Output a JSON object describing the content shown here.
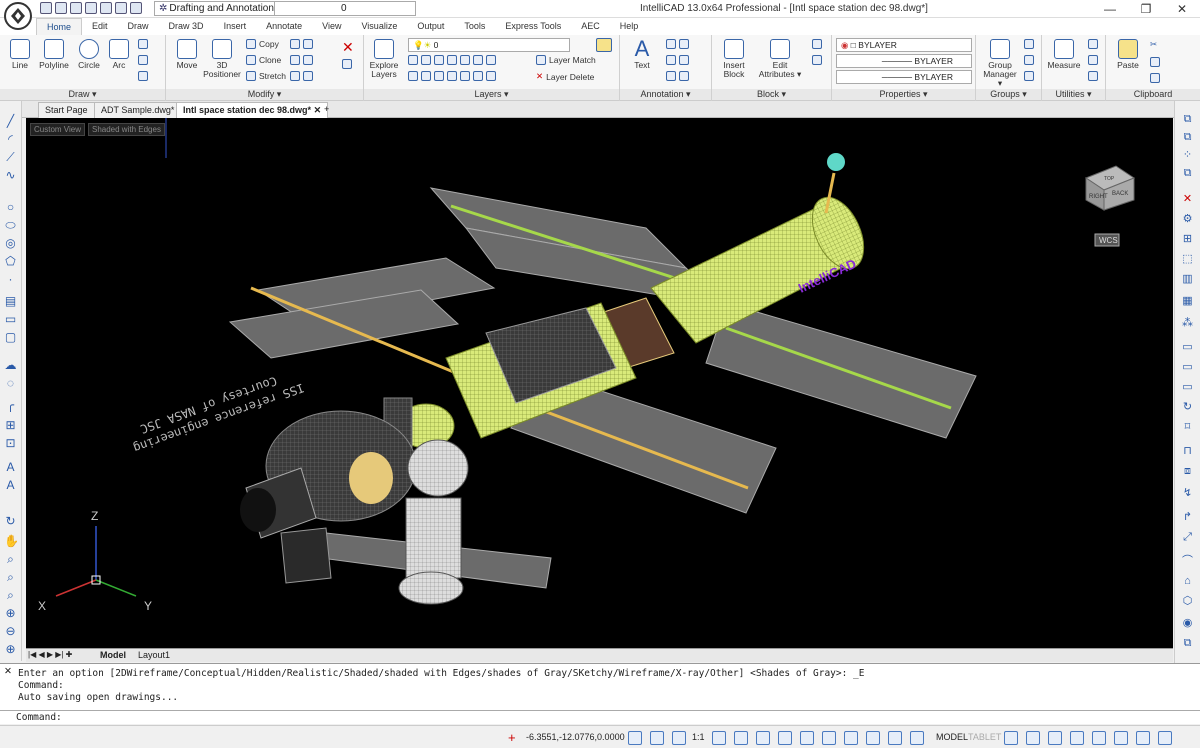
{
  "window": {
    "title": "IntelliCAD 13.0x64 Professional  - [Intl space station dec 98.dwg*]",
    "controls": [
      "—",
      "❐",
      "✕"
    ]
  },
  "qat": {
    "workspace": "Drafting and Annotation",
    "layer_value": "0"
  },
  "menu": [
    "Home",
    "Edit",
    "Draw",
    "Draw 3D",
    "Insert",
    "Annotate",
    "View",
    "Visualize",
    "Output",
    "Tools",
    "Express Tools",
    "AEC",
    "Help"
  ],
  "ribbon": {
    "draw": {
      "label": "Draw ▾",
      "tools": [
        "Line",
        "Polyline",
        "Circle",
        "Arc"
      ]
    },
    "modify": {
      "label": "Modify ▾",
      "move": "Move",
      "positioner": "3D\nPositioner",
      "copy": "Copy",
      "clone": "Clone",
      "stretch": "Stretch"
    },
    "layers": {
      "label": "Layers ▾",
      "explore": "Explore\nLayers",
      "layer_value": "0",
      "match": "Layer Match",
      "delete": "Layer Delete"
    },
    "annotation": {
      "label": "Annotation ▾",
      "text": "Text"
    },
    "block": {
      "label": "Block ▾",
      "insert": "Insert\nBlock",
      "edit": "Edit\nAttributes ▾"
    },
    "properties": {
      "label": "Properties ▾",
      "color": "BYLAYER",
      "linetype": "BYLAYER",
      "lineweight": "BYLAYER"
    },
    "groups": {
      "label": "Groups ▾",
      "manager": "Group\nManager ▾"
    },
    "utilities": {
      "label": "Utilities ▾",
      "measure": "Measure"
    },
    "clipboard": {
      "label": "Clipboard",
      "paste": "Paste"
    }
  },
  "doc_tabs": [
    "Start Page",
    "ADT Sample.dwg*",
    "Intl space station dec 98.dwg*",
    "+"
  ],
  "viewport": {
    "view": "Custom View",
    "style": "Shaded with Edges",
    "brand": "IntelliCAD",
    "credit_line1": "ISS reference engineering",
    "credit_line2": "Courtesy of NASA JSC",
    "wcs": "WCS",
    "cube": [
      "RIGHT",
      "BACK",
      "TOP"
    ],
    "axes": {
      "x": "X",
      "y": "Y",
      "z": "Z"
    }
  },
  "layout_tabs": {
    "model": "Model",
    "layout1": "Layout1"
  },
  "command": {
    "lines": [
      "Enter an option [2DWireframe/Conceptual/Hidden/Realistic/Shaded/shaded with Edges/shades of Gray/SKetchy/Wireframe/X-ray/Other] <Shades of Gray>: _E",
      "Command:",
      "Auto saving open drawings..."
    ],
    "prompt": "Command:"
  },
  "status": {
    "coords": "-6.3551,-12.0776,0.0000",
    "scale": "1:1",
    "model": "MODEL",
    "tablet": "TABLET"
  }
}
